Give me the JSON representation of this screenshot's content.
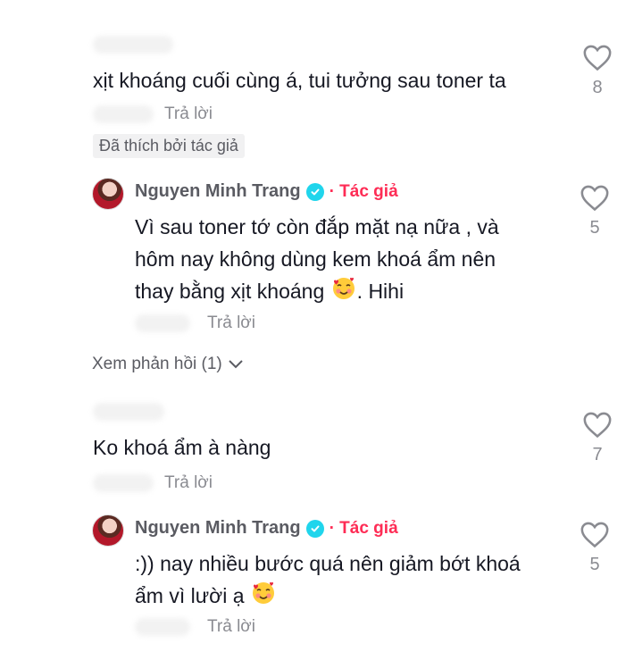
{
  "comments": [
    {
      "text": "xịt khoáng cuối cùng á, tui tưởng sau toner ta",
      "reply_label": "Trả lời",
      "liked_by_author": "Đã thích bởi tác giả",
      "likes": "8",
      "reply": {
        "username": "Nguyen Minh Trang",
        "author_tag": "· Tác giả",
        "lines": [
          "Vì sau toner tớ còn đắp mặt nạ nữa , và",
          "hôm nay không dùng kem khoá ẩm nên",
          "thay bằng xịt khoáng",
          ". Hihi"
        ],
        "reply_label": "Trả lời",
        "likes": "5"
      },
      "view_replies": "Xem phản hồi (1)"
    },
    {
      "text": "Ko khoá ẩm à nàng",
      "reply_label": "Trả lời",
      "likes": "7",
      "reply": {
        "username": "Nguyen Minh Trang",
        "author_tag": "· Tác giả",
        "lines": [
          ":)) nay nhiều bước quá nên giảm bớt khoá",
          "ẩm vì lười ạ"
        ],
        "reply_label": "Trả lời",
        "likes": "5"
      }
    }
  ],
  "icons": {
    "like": "heart-outline-icon",
    "verified": "verified-badge-icon",
    "chevron": "chevron-down-icon",
    "emoji": "smiling-face-with-hearts-icon"
  },
  "colors": {
    "author_tag": "#fe2c55",
    "verified": "#20d5ec",
    "muted": "#8a8b91"
  }
}
